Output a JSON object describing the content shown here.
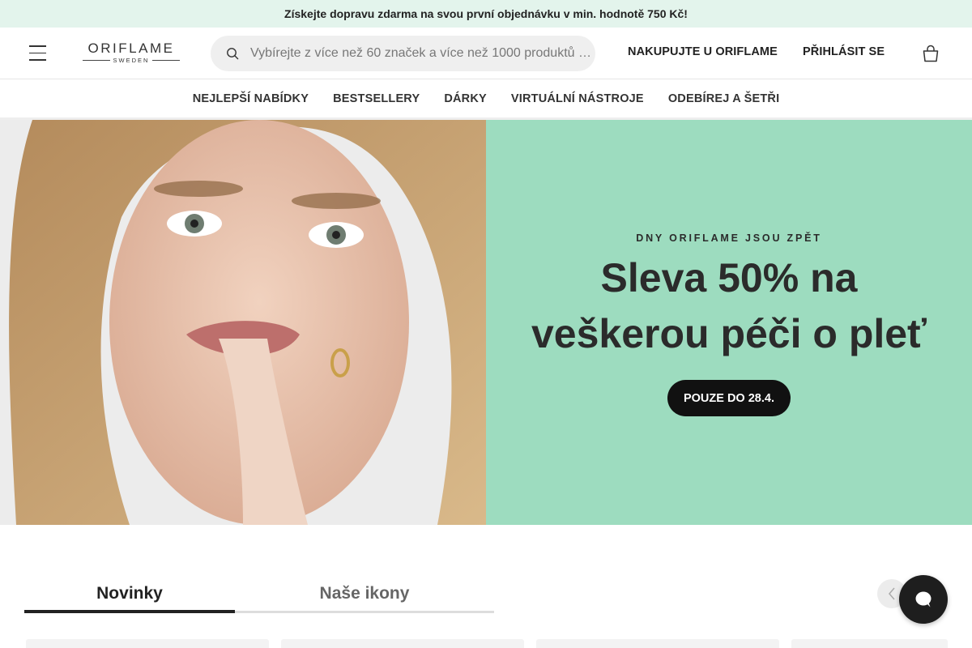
{
  "promo": {
    "text": "Získejte dopravu zdarma na svou první objednávku v min. hodnotě 750 Kč!"
  },
  "header": {
    "logo_text": "ORIFLAME",
    "logo_sub": "SWEDEN",
    "search_placeholder": "Vybírejte z více než 60 značek a více než 1000 produktů …",
    "shop_link": "NAKUPUJTE U ORIFLAME",
    "login_link": "PŘIHLÁSIT SE",
    "icons": [
      "menu-icon",
      "search-icon",
      "cart-icon"
    ]
  },
  "catnav": {
    "items": [
      "NEJLEPŠÍ NABÍDKY",
      "BESTSELLERY",
      "DÁRKY",
      "VIRTUÁLNÍ NÁSTROJE",
      "ODEBÍREJ A ŠETŘI"
    ]
  },
  "hero": {
    "eyebrow": "DNY ORIFLAME JSOU ZPĚT",
    "title_line1": "Sleva 50% na",
    "title_line2": "veškerou péči o pleť",
    "cta": "POUZE DO 28.4.",
    "panel_color": "#9ddcbf"
  },
  "tabs": {
    "items": [
      "Novinky",
      "Naše ikony"
    ],
    "active": "Novinky"
  },
  "colors": {
    "promo_bg": "#e3f4ec",
    "accent_dark": "#111111",
    "hero_green": "#9ddcbf"
  }
}
